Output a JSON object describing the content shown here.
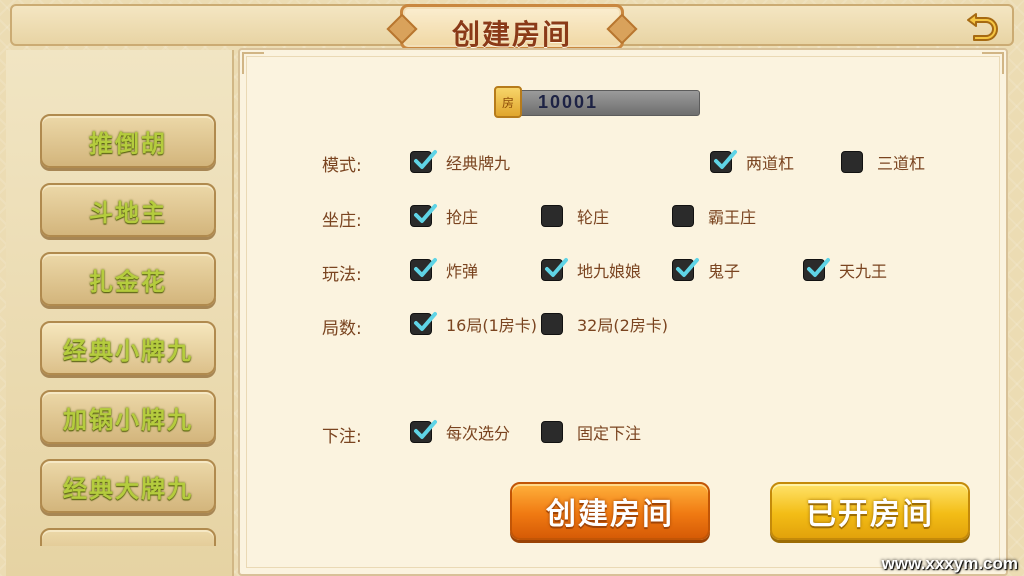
{
  "header": {
    "title": "创建房间",
    "back_icon": "return-arrow-icon"
  },
  "categories": [
    {
      "label": "推倒胡"
    },
    {
      "label": "斗地主"
    },
    {
      "label": "扎金花"
    },
    {
      "label": "经典小牌九"
    },
    {
      "label": "加锅小牌九"
    },
    {
      "label": "经典大牌九"
    }
  ],
  "room": {
    "badge": "房",
    "number": "10001"
  },
  "rows": [
    {
      "label": "模式:",
      "options": [
        {
          "label": "经典牌九",
          "checked": true
        },
        {
          "label": "两道杠",
          "checked": true
        },
        {
          "label": "三道杠",
          "checked": false
        }
      ]
    },
    {
      "label": "坐庄:",
      "options": [
        {
          "label": "抢庄",
          "checked": true
        },
        {
          "label": "轮庄",
          "checked": false
        },
        {
          "label": "霸王庄",
          "checked": false
        }
      ]
    },
    {
      "label": "玩法:",
      "options": [
        {
          "label": "炸弹",
          "checked": true
        },
        {
          "label": "地九娘娘",
          "checked": true
        },
        {
          "label": "鬼子",
          "checked": true
        },
        {
          "label": "天九王",
          "checked": true
        }
      ]
    },
    {
      "label": "局数:",
      "options": [
        {
          "label": "16局(1房卡)",
          "checked": true
        },
        {
          "label": "32局(2房卡)",
          "checked": false
        }
      ]
    },
    {
      "label": "下注:",
      "options": [
        {
          "label": "每次选分",
          "checked": true
        },
        {
          "label": "固定下注",
          "checked": false
        }
      ]
    }
  ],
  "buttons": {
    "create": "创建房间",
    "opened": "已开房间"
  },
  "watermark": "www.xxxym.com",
  "colors": {
    "accent_orange": "#f07a12",
    "accent_yellow": "#f3bd16",
    "check_tick": "#5fd4e6",
    "label_brown": "#7a4420"
  }
}
